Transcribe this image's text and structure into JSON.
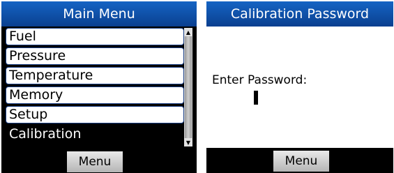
{
  "main_menu": {
    "title": "Main Menu",
    "items": [
      {
        "label": "Fuel"
      },
      {
        "label": "Pressure"
      },
      {
        "label": "Temperature"
      },
      {
        "label": "Memory"
      },
      {
        "label": "Setup"
      },
      {
        "label": "Calibration",
        "selected": true
      }
    ],
    "softkey_label": "Menu",
    "scroll_up_icon": "▲",
    "scroll_down_icon": "▼"
  },
  "calibration_password": {
    "title": "Calibration Password",
    "prompt": "Enter Password:",
    "password_value": "",
    "softkey_label": "Menu"
  },
  "colors": {
    "title_bar": "#0a3f8f",
    "item_border": "#1a3f86",
    "selected_bg": "#000000",
    "softkey_bg": "#c8c8c8"
  }
}
